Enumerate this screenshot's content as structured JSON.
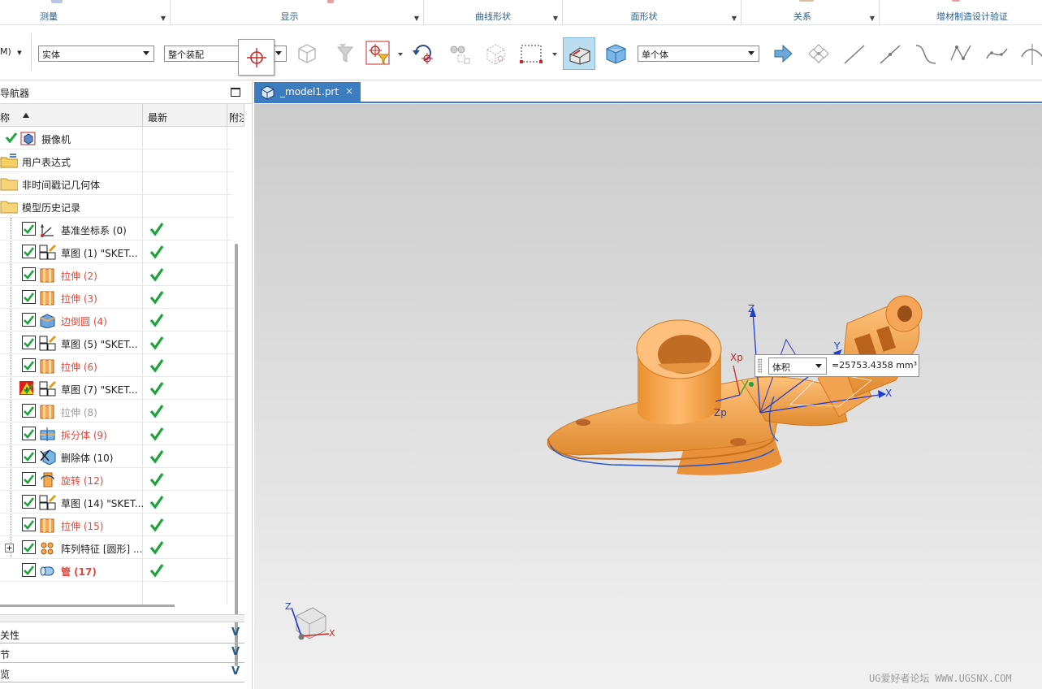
{
  "ribbon": {
    "groups": [
      {
        "label": "测量"
      },
      {
        "label": "显示"
      },
      {
        "label": "曲线形状"
      },
      {
        "label": "面形状"
      },
      {
        "label": "关系"
      },
      {
        "label": "增材制造设计验证"
      }
    ]
  },
  "toolbar": {
    "menu_fragment": "M)",
    "type_filter": {
      "value": "实体"
    },
    "scope_filter": {
      "value": "整个装配"
    },
    "body_rule": {
      "value": "单个体"
    }
  },
  "navigator": {
    "title": "导航器",
    "columns": {
      "name": "称",
      "latest": "最新",
      "attached": "附注"
    },
    "items": [
      {
        "label": "摄像机",
        "style": "normal",
        "status_check": true,
        "latest": false
      },
      {
        "label": "用户表达式",
        "style": "normal",
        "latest": false
      },
      {
        "label": "非时间戳记几何体",
        "style": "normal",
        "latest": false
      },
      {
        "label": "模型历史记录",
        "style": "normal",
        "latest": false
      },
      {
        "label": "基准坐标系 (0)",
        "style": "normal",
        "icon": "datum-csys-icon",
        "latest": true
      },
      {
        "label": "草图 (1) \"SKET...",
        "style": "normal",
        "icon": "sketch-icon",
        "latest": true
      },
      {
        "label": "拉伸 (2)",
        "style": "red",
        "icon": "extrude-icon",
        "latest": true
      },
      {
        "label": "拉伸 (3)",
        "style": "red",
        "icon": "extrude-icon",
        "latest": true
      },
      {
        "label": "边倒圆 (4)",
        "style": "red",
        "icon": "edge-blend-icon",
        "latest": true
      },
      {
        "label": "草图 (5) \"SKET...",
        "style": "normal",
        "icon": "sketch-icon",
        "latest": true
      },
      {
        "label": "拉伸 (6)",
        "style": "red",
        "icon": "extrude-icon",
        "latest": true
      },
      {
        "label": "草图 (7) \"SKET...",
        "style": "normal",
        "icon": "sketch-icon",
        "warning": true,
        "latest": true
      },
      {
        "label": "拉伸 (8)",
        "style": "gray",
        "icon": "extrude-icon",
        "latest": true
      },
      {
        "label": "拆分体 (9)",
        "style": "red",
        "icon": "split-body-icon",
        "latest": true
      },
      {
        "label": "删除体 (10)",
        "style": "normal",
        "icon": "delete-body-icon",
        "latest": true
      },
      {
        "label": "旋转 (12)",
        "style": "red",
        "icon": "revolve-icon",
        "latest": true
      },
      {
        "label": "草图 (14) \"SKET...",
        "style": "normal",
        "icon": "sketch-icon",
        "latest": true
      },
      {
        "label": "拉伸 (15)",
        "style": "red",
        "icon": "extrude-icon",
        "latest": true
      },
      {
        "label": "阵列特征 [圆形] ...",
        "style": "normal",
        "icon": "pattern-feature-icon",
        "expandable": true,
        "latest": true
      },
      {
        "label": "管 (17)",
        "style": "red-bold",
        "icon": "tube-icon",
        "latest": true
      }
    ],
    "panels": [
      {
        "label": "关性"
      },
      {
        "label": "节"
      },
      {
        "label": "览"
      }
    ]
  },
  "graphics": {
    "tab_label": "_model1.prt",
    "tab_close": "×",
    "measure": {
      "type": "体积",
      "value": "=25753.4358 mm³"
    },
    "axis_labels": {
      "z": "Z",
      "y": "Y",
      "x": "X",
      "xp": "Xp",
      "zp": "Zp"
    },
    "triad": {
      "z": "Z",
      "x": "X"
    }
  },
  "watermark": "UG爱好者论坛 WWW.UGSNX.COM",
  "colors": {
    "accent": "#3b7dbf",
    "part": "#f6a953",
    "feature_red": "#e5473a",
    "check_green": "#1aa637"
  }
}
